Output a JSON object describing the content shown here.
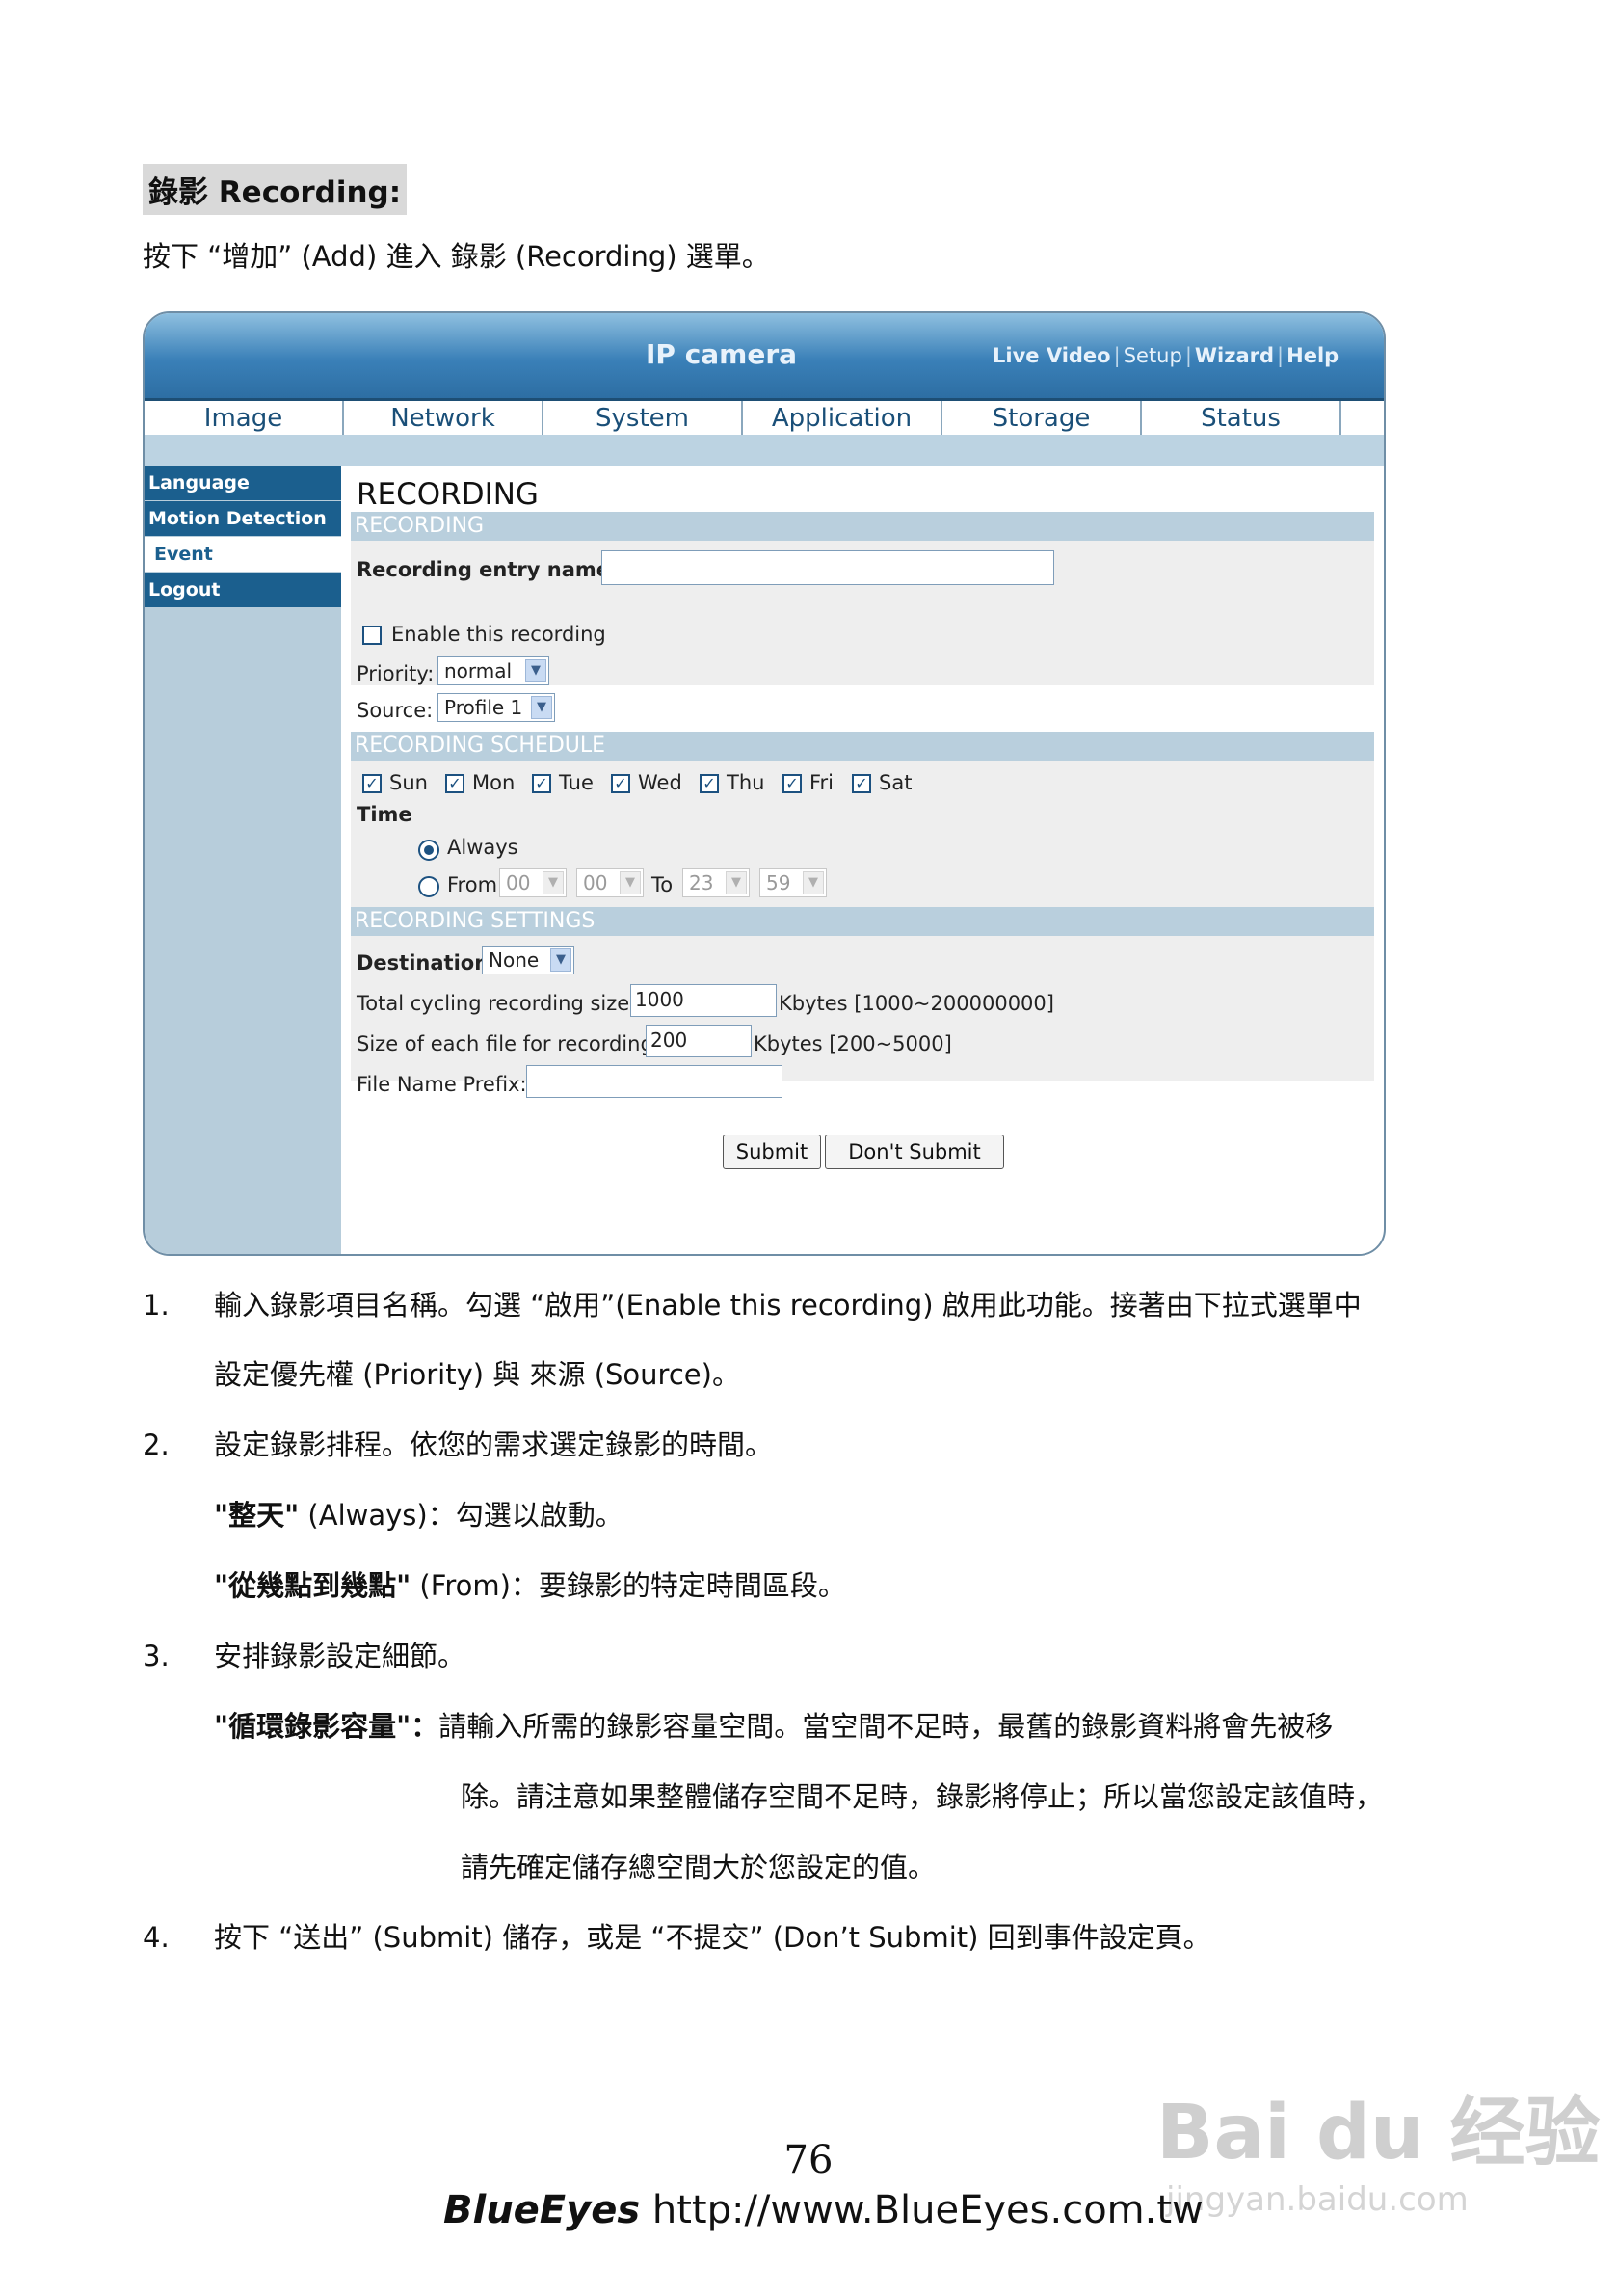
{
  "heading": "錄影 Recording:",
  "intro": "按下 “增加” (Add) 進入 錄影 (Recording) 選單。",
  "screenshot": {
    "app_title": "IP camera",
    "top_links": [
      "Live Video",
      "Setup",
      "Wizard",
      "Help"
    ],
    "nav_tabs": [
      "Image",
      "Network",
      "System",
      "Application",
      "Storage",
      "Status"
    ],
    "sidebar_items": [
      "Language",
      "Motion Detection",
      "Event",
      "Logout"
    ],
    "page_title": "RECORDING",
    "section_recording": "RECORDING",
    "entry_name_label": "Recording entry name:",
    "entry_name_value": "",
    "enable_label": "Enable this recording",
    "priority_label": "Priority:",
    "priority_value": "normal",
    "source_label": "Source:",
    "source_value": "Profile 1",
    "section_schedule": "RECORDING SCHEDULE",
    "days": [
      "Sun",
      "Mon",
      "Tue",
      "Wed",
      "Thu",
      "Fri",
      "Sat"
    ],
    "time_label": "Time",
    "always_label": "Always",
    "from_label": "From",
    "to_label": "To",
    "from_hour": "00",
    "from_min": "00",
    "to_hour": "23",
    "to_min": "59",
    "section_settings": "RECORDING SETTINGS",
    "destination_label": "Destination",
    "destination_value": "None",
    "total_size_label": "Total cycling recording size:",
    "total_size_value": "1000",
    "total_size_unit": "Kbytes [1000~200000000]",
    "file_size_label": "Size of each file for recording:",
    "file_size_value": "200",
    "file_size_unit": "Kbytes [200~5000]",
    "prefix_label": "File Name Prefix:",
    "prefix_value": "",
    "submit_label": "Submit",
    "dont_submit_label": "Don't Submit"
  },
  "list": {
    "n1": "1.",
    "i1_line1": "輸入錄影項目名稱。勾選 “啟用”(Enable this recording) 啟用此功能。接著由下拉式選單中",
    "i1_line2": "設定優先權 (Priority) 與 來源 (Source)。",
    "n2": "2.",
    "i2": "設定錄影排程。依您的需求選定錄影的時間。",
    "always_bold": "\"整天\"",
    "always_rest": " (Always)：勾選以啟動。",
    "from_bold": "\"從幾點到幾點\"",
    "from_rest": " (From)：要錄影的特定時間區段。",
    "n3": "3.",
    "i3": "安排錄影設定細節。",
    "cycle_bold": "\"循環錄影容量\"：",
    "cycle_line1": "請輸入所需的錄影容量空間。當空間不足時，最舊的錄影資料將會先被移",
    "cycle_line2": "除。請注意如果整體儲存空間不足時，錄影將停止；所以當您設定該值時，",
    "cycle_line3": "請先確定儲存總空間大於您設定的值。",
    "n4": "4.",
    "i4": "按下 “送出” (Submit) 儲存，或是 “不提交” (Don’t Submit) 回到事件設定頁。"
  },
  "page_number": "76",
  "footer_brand": "BlueEyes",
  "footer_url": "http://www.BlueEyes.com.tw",
  "watermark": "Bai du 经验",
  "watermark_url": "jingyan.baidu.com"
}
